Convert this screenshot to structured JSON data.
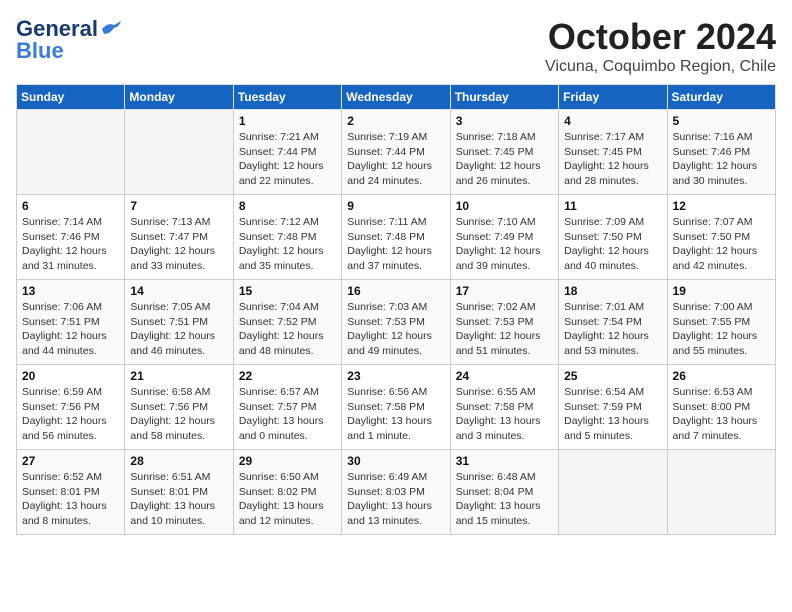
{
  "header": {
    "logo_line1": "General",
    "logo_line2": "Blue",
    "month": "October 2024",
    "location": "Vicuna, Coquimbo Region, Chile"
  },
  "days_of_week": [
    "Sunday",
    "Monday",
    "Tuesday",
    "Wednesday",
    "Thursday",
    "Friday",
    "Saturday"
  ],
  "weeks": [
    [
      {
        "day": "",
        "info": ""
      },
      {
        "day": "",
        "info": ""
      },
      {
        "day": "1",
        "info": "Sunrise: 7:21 AM\nSunset: 7:44 PM\nDaylight: 12 hours and 22 minutes."
      },
      {
        "day": "2",
        "info": "Sunrise: 7:19 AM\nSunset: 7:44 PM\nDaylight: 12 hours and 24 minutes."
      },
      {
        "day": "3",
        "info": "Sunrise: 7:18 AM\nSunset: 7:45 PM\nDaylight: 12 hours and 26 minutes."
      },
      {
        "day": "4",
        "info": "Sunrise: 7:17 AM\nSunset: 7:45 PM\nDaylight: 12 hours and 28 minutes."
      },
      {
        "day": "5",
        "info": "Sunrise: 7:16 AM\nSunset: 7:46 PM\nDaylight: 12 hours and 30 minutes."
      }
    ],
    [
      {
        "day": "6",
        "info": "Sunrise: 7:14 AM\nSunset: 7:46 PM\nDaylight: 12 hours and 31 minutes."
      },
      {
        "day": "7",
        "info": "Sunrise: 7:13 AM\nSunset: 7:47 PM\nDaylight: 12 hours and 33 minutes."
      },
      {
        "day": "8",
        "info": "Sunrise: 7:12 AM\nSunset: 7:48 PM\nDaylight: 12 hours and 35 minutes."
      },
      {
        "day": "9",
        "info": "Sunrise: 7:11 AM\nSunset: 7:48 PM\nDaylight: 12 hours and 37 minutes."
      },
      {
        "day": "10",
        "info": "Sunrise: 7:10 AM\nSunset: 7:49 PM\nDaylight: 12 hours and 39 minutes."
      },
      {
        "day": "11",
        "info": "Sunrise: 7:09 AM\nSunset: 7:50 PM\nDaylight: 12 hours and 40 minutes."
      },
      {
        "day": "12",
        "info": "Sunrise: 7:07 AM\nSunset: 7:50 PM\nDaylight: 12 hours and 42 minutes."
      }
    ],
    [
      {
        "day": "13",
        "info": "Sunrise: 7:06 AM\nSunset: 7:51 PM\nDaylight: 12 hours and 44 minutes."
      },
      {
        "day": "14",
        "info": "Sunrise: 7:05 AM\nSunset: 7:51 PM\nDaylight: 12 hours and 46 minutes."
      },
      {
        "day": "15",
        "info": "Sunrise: 7:04 AM\nSunset: 7:52 PM\nDaylight: 12 hours and 48 minutes."
      },
      {
        "day": "16",
        "info": "Sunrise: 7:03 AM\nSunset: 7:53 PM\nDaylight: 12 hours and 49 minutes."
      },
      {
        "day": "17",
        "info": "Sunrise: 7:02 AM\nSunset: 7:53 PM\nDaylight: 12 hours and 51 minutes."
      },
      {
        "day": "18",
        "info": "Sunrise: 7:01 AM\nSunset: 7:54 PM\nDaylight: 12 hours and 53 minutes."
      },
      {
        "day": "19",
        "info": "Sunrise: 7:00 AM\nSunset: 7:55 PM\nDaylight: 12 hours and 55 minutes."
      }
    ],
    [
      {
        "day": "20",
        "info": "Sunrise: 6:59 AM\nSunset: 7:56 PM\nDaylight: 12 hours and 56 minutes."
      },
      {
        "day": "21",
        "info": "Sunrise: 6:58 AM\nSunset: 7:56 PM\nDaylight: 12 hours and 58 minutes."
      },
      {
        "day": "22",
        "info": "Sunrise: 6:57 AM\nSunset: 7:57 PM\nDaylight: 13 hours and 0 minutes."
      },
      {
        "day": "23",
        "info": "Sunrise: 6:56 AM\nSunset: 7:58 PM\nDaylight: 13 hours and 1 minute."
      },
      {
        "day": "24",
        "info": "Sunrise: 6:55 AM\nSunset: 7:58 PM\nDaylight: 13 hours and 3 minutes."
      },
      {
        "day": "25",
        "info": "Sunrise: 6:54 AM\nSunset: 7:59 PM\nDaylight: 13 hours and 5 minutes."
      },
      {
        "day": "26",
        "info": "Sunrise: 6:53 AM\nSunset: 8:00 PM\nDaylight: 13 hours and 7 minutes."
      }
    ],
    [
      {
        "day": "27",
        "info": "Sunrise: 6:52 AM\nSunset: 8:01 PM\nDaylight: 13 hours and 8 minutes."
      },
      {
        "day": "28",
        "info": "Sunrise: 6:51 AM\nSunset: 8:01 PM\nDaylight: 13 hours and 10 minutes."
      },
      {
        "day": "29",
        "info": "Sunrise: 6:50 AM\nSunset: 8:02 PM\nDaylight: 13 hours and 12 minutes."
      },
      {
        "day": "30",
        "info": "Sunrise: 6:49 AM\nSunset: 8:03 PM\nDaylight: 13 hours and 13 minutes."
      },
      {
        "day": "31",
        "info": "Sunrise: 6:48 AM\nSunset: 8:04 PM\nDaylight: 13 hours and 15 minutes."
      },
      {
        "day": "",
        "info": ""
      },
      {
        "day": "",
        "info": ""
      }
    ]
  ]
}
